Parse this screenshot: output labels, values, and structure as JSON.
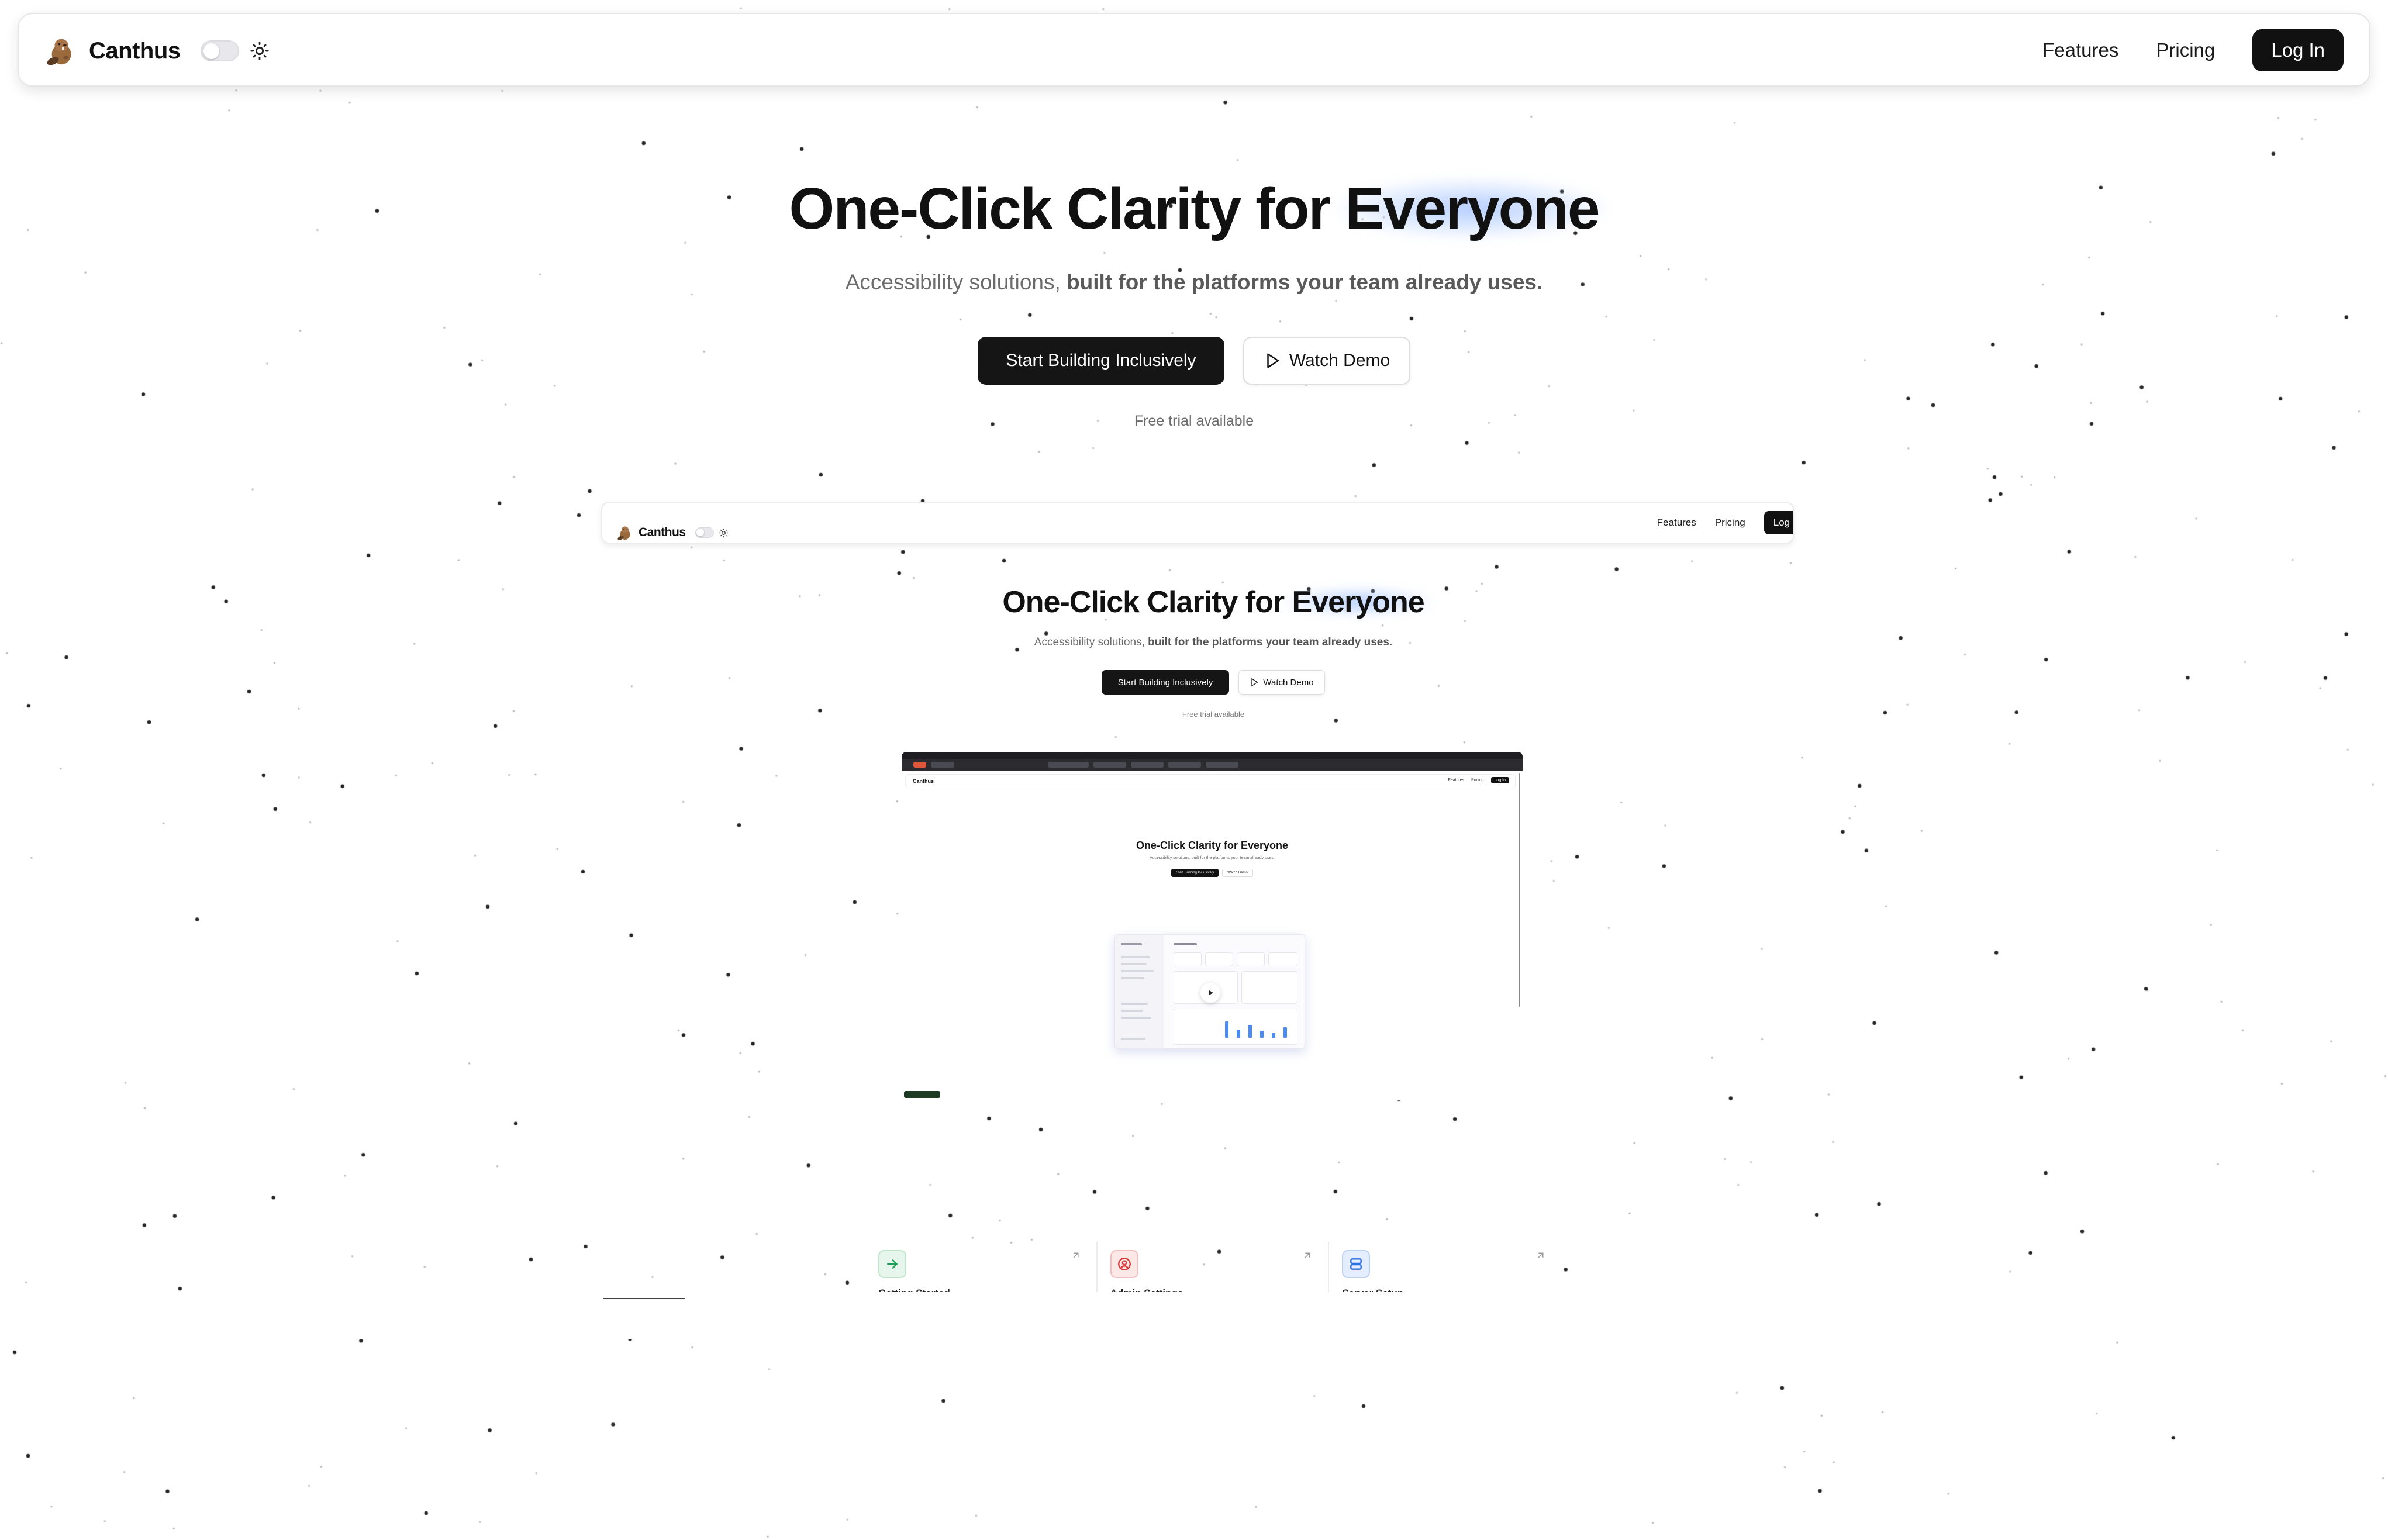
{
  "nav": {
    "brand": "Canthus",
    "links": [
      "Features",
      "Pricing"
    ],
    "login": "Log In"
  },
  "hero": {
    "title_prefix": "One-Click Clarity for ",
    "title_highlight": "Everyone",
    "subtitle_plain": "Accessibility solutions,",
    "subtitle_bold": "built for the platforms your team already uses.",
    "cta_primary": "Start Building Inclusively",
    "cta_secondary": "Watch Demo",
    "trial": "Free trial available"
  },
  "preview": {
    "brand": "Canthus",
    "links": [
      "Features",
      "Pricing"
    ],
    "login": "Log In",
    "title_prefix": "One-Click Clarity for ",
    "title_highlight": "Everyone",
    "subtitle_plain": "Accessibility solutions,",
    "subtitle_bold": "built for the platforms your team already uses.",
    "cta_primary": "Start Building Inclusively",
    "cta_secondary": "Watch Demo",
    "trial": "Free trial available",
    "inner": {
      "brand": "Canthus",
      "links": [
        "Features",
        "Pricing"
      ],
      "login": "Log In",
      "title_prefix": "One-Click Clarity for ",
      "title_highlight": "Everyone",
      "subtitle": "Accessibility solutions, built for the platforms your team already uses.",
      "cta_primary": "Start Building Inclusively",
      "cta_secondary": "Watch Demo"
    }
  },
  "cards": [
    {
      "label": "Getting Started",
      "icon": "arrow-right-icon",
      "color": "#1f9d55",
      "bg": "#e7f6ec"
    },
    {
      "label": "Admin Settings",
      "icon": "user-circle-icon",
      "color": "#d63a3a",
      "bg": "#fde8e8"
    },
    {
      "label": "Server Setup",
      "icon": "server-icon",
      "color": "#2f6fde",
      "bg": "#e5eeff"
    }
  ],
  "colors": {
    "accent_dark": "#111111",
    "highlight_glow": "#8fb4ff"
  }
}
